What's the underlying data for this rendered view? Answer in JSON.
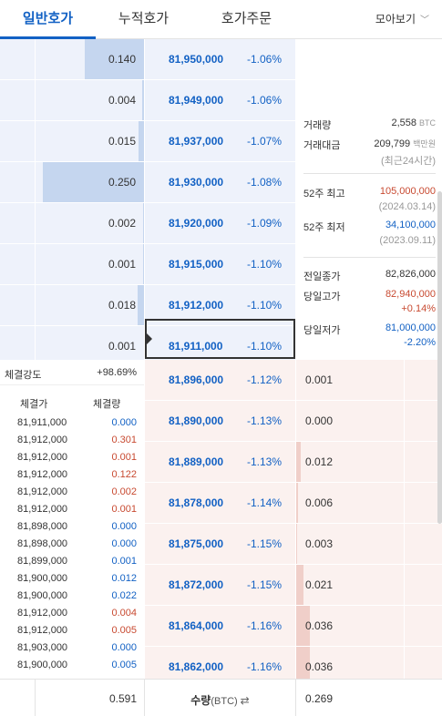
{
  "tabs": [
    {
      "label": "일반호가"
    },
    {
      "label": "누적호가"
    },
    {
      "label": "호가주문"
    }
  ],
  "view_mode": {
    "label": "모아보기"
  },
  "asks": [
    {
      "qty": "0.140",
      "price": "81,950,000",
      "pct": "-1.06%",
      "bar_fraction": 0.55
    },
    {
      "qty": "0.004",
      "price": "81,949,000",
      "pct": "-1.06%",
      "bar_fraction": 0.02
    },
    {
      "qty": "0.015",
      "price": "81,937,000",
      "pct": "-1.07%",
      "bar_fraction": 0.05
    },
    {
      "qty": "0.250",
      "price": "81,930,000",
      "pct": "-1.08%",
      "bar_fraction": 0.93
    },
    {
      "qty": "0.002",
      "price": "81,920,000",
      "pct": "-1.09%",
      "bar_fraction": 0.01
    },
    {
      "qty": "0.001",
      "price": "81,915,000",
      "pct": "-1.10%",
      "bar_fraction": 0.01
    },
    {
      "qty": "0.018",
      "price": "81,912,000",
      "pct": "-1.10%",
      "bar_fraction": 0.06
    },
    {
      "qty": "0.001",
      "price": "81,911,000",
      "pct": "-1.10%",
      "bar_fraction": 0.0
    }
  ],
  "bids": [
    {
      "qty": "0.001",
      "price": "81,896,000",
      "pct": "-1.12%",
      "bar_fraction": 0.0
    },
    {
      "qty": "0.000",
      "price": "81,890,000",
      "pct": "-1.13%",
      "bar_fraction": 0.0
    },
    {
      "qty": "0.012",
      "price": "81,889,000",
      "pct": "-1.13%",
      "bar_fraction": 0.04
    },
    {
      "qty": "0.006",
      "price": "81,878,000",
      "pct": "-1.14%",
      "bar_fraction": 0.02
    },
    {
      "qty": "0.003",
      "price": "81,875,000",
      "pct": "-1.15%",
      "bar_fraction": 0.01
    },
    {
      "qty": "0.021",
      "price": "81,872,000",
      "pct": "-1.15%",
      "bar_fraction": 0.07
    },
    {
      "qty": "0.036",
      "price": "81,864,000",
      "pct": "-1.16%",
      "bar_fraction": 0.13
    },
    {
      "qty": "0.036",
      "price": "81,862,000",
      "pct": "-1.16%",
      "bar_fraction": 0.13
    }
  ],
  "info": {
    "volume_label": "거래량",
    "volume": "2,558",
    "volume_unit": "BTC",
    "amount_label": "거래대금",
    "amount": "209,799",
    "amount_unit": "백만원",
    "amount_note": "(최근24시간)",
    "high52_label": "52주 최고",
    "high52": "105,000,000",
    "high52_date": "(2024.03.14)",
    "low52_label": "52주 최저",
    "low52": "34,100,000",
    "low52_date": "(2023.09.11)",
    "prev_close_label": "전일종가",
    "prev_close": "82,826,000",
    "day_high_label": "당일고가",
    "day_high": "82,940,000",
    "day_high_pct": "+0.14%",
    "day_low_label": "당일저가",
    "day_low": "81,000,000",
    "day_low_pct": "-2.20%"
  },
  "strength": {
    "label": "체결강도",
    "value": "+98.69%"
  },
  "trades_header": {
    "price": "체결가",
    "volume": "체결량"
  },
  "trades": [
    {
      "price": "81,911,000",
      "volume": "0.000",
      "side": "sell"
    },
    {
      "price": "81,912,000",
      "volume": "0.301",
      "side": "buy"
    },
    {
      "price": "81,912,000",
      "volume": "0.001",
      "side": "buy"
    },
    {
      "price": "81,912,000",
      "volume": "0.122",
      "side": "buy"
    },
    {
      "price": "81,912,000",
      "volume": "0.002",
      "side": "buy"
    },
    {
      "price": "81,912,000",
      "volume": "0.001",
      "side": "buy"
    },
    {
      "price": "81,898,000",
      "volume": "0.000",
      "side": "sell"
    },
    {
      "price": "81,898,000",
      "volume": "0.000",
      "side": "sell"
    },
    {
      "price": "81,899,000",
      "volume": "0.001",
      "side": "sell"
    },
    {
      "price": "81,900,000",
      "volume": "0.012",
      "side": "sell"
    },
    {
      "price": "81,900,000",
      "volume": "0.022",
      "side": "sell"
    },
    {
      "price": "81,912,000",
      "volume": "0.004",
      "side": "buy"
    },
    {
      "price": "81,912,000",
      "volume": "0.005",
      "side": "buy"
    },
    {
      "price": "81,903,000",
      "volume": "0.000",
      "side": "sell"
    },
    {
      "price": "81,900,000",
      "volume": "0.005",
      "side": "sell"
    }
  ],
  "footer": {
    "ask_total": "0.591",
    "qty_label": "수량",
    "qty_unit": "(BTC)",
    "swap_icon": "⇄",
    "bid_total": "0.269"
  },
  "colors": {
    "ask_blue": "#1261c4",
    "bid_red": "#c84a31",
    "ask_bg": "#eef2fb",
    "bid_bg": "#fbf1ef"
  }
}
